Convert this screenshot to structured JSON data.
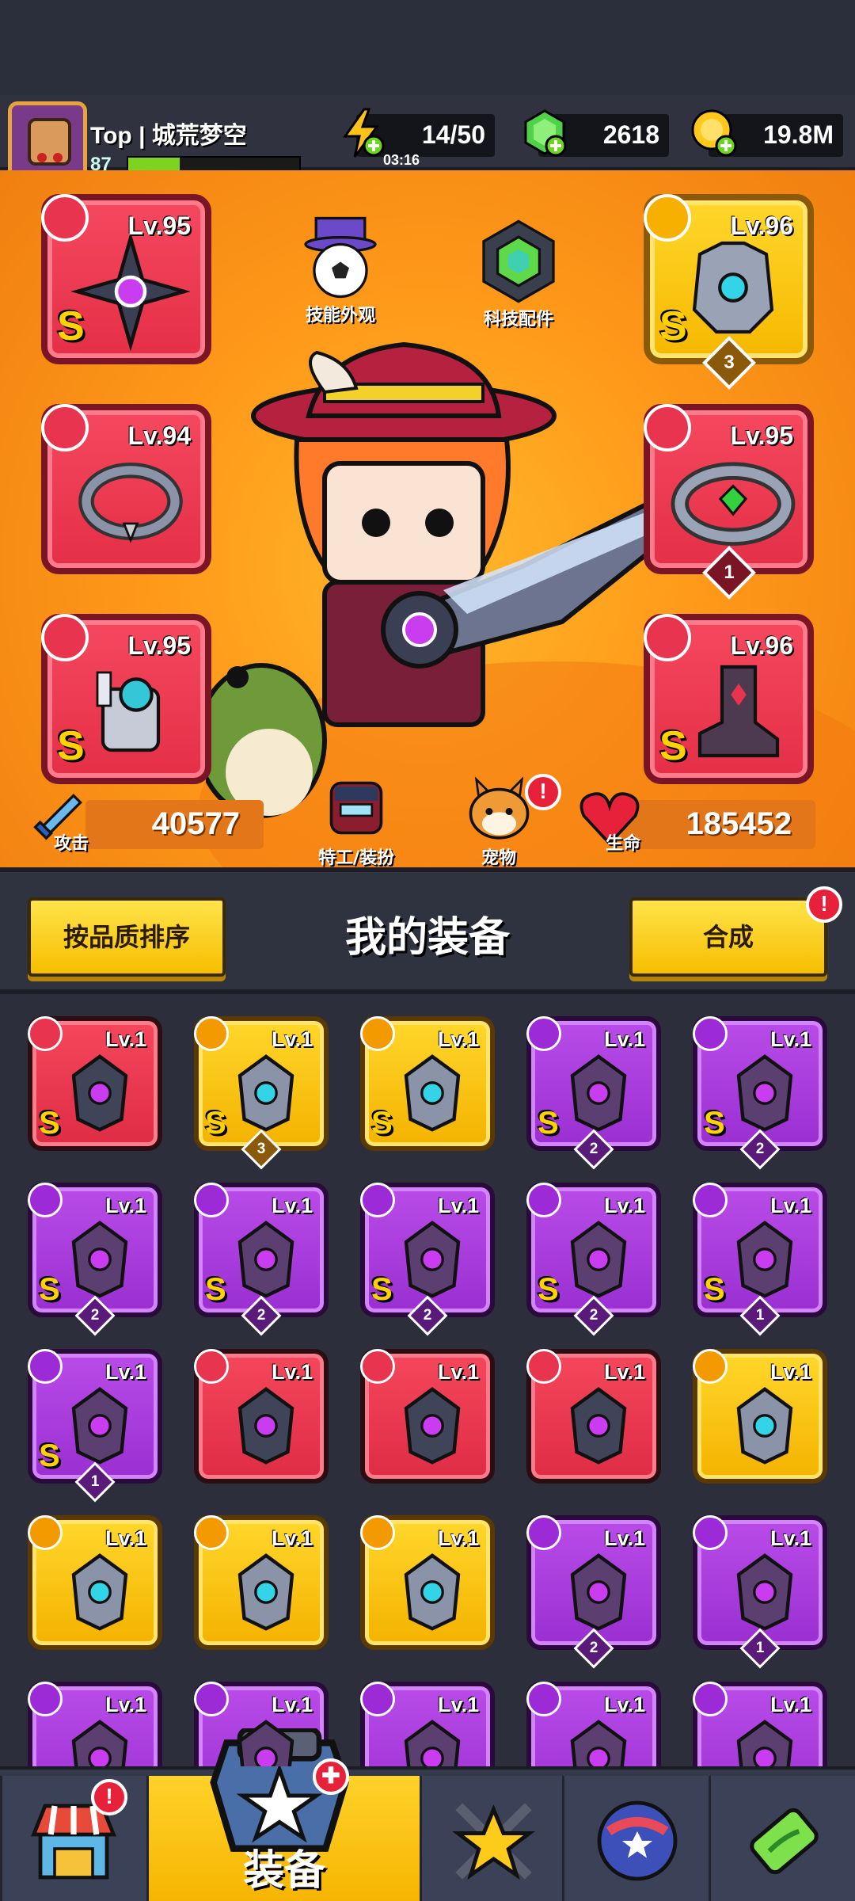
{
  "header": {
    "player_name": "Top | 城荒梦空",
    "player_level": "87",
    "xp_fraction": 0.3,
    "energy": "14/50",
    "energy_timer": "03:16",
    "gems": "2618",
    "coins": "19.8M"
  },
  "equipped": {
    "weapon": {
      "level": "Lv.95",
      "grade": "S"
    },
    "armor": {
      "level": "Lv.96",
      "grade": "S",
      "stars": "3"
    },
    "necklace": {
      "level": "Lv.94"
    },
    "ring": {
      "level": "Lv.95",
      "stars": "1"
    },
    "gloves": {
      "level": "Lv.95",
      "grade": "S"
    },
    "boots": {
      "level": "Lv.96",
      "grade": "S"
    }
  },
  "hero_buttons": {
    "skill_skin": "技能外观",
    "tech_parts": "科技配件",
    "agent_outfit": "特工/装扮",
    "pets": "宠物"
  },
  "stats": {
    "attack_label": "攻击",
    "attack_value": "40577",
    "hp_label": "生命",
    "hp_value": "185452"
  },
  "inventory_bar": {
    "sort_label": "按品质排序",
    "title": "我的装备",
    "merge_label": "合成"
  },
  "inventory": [
    {
      "rarity": "red",
      "level": "Lv.1",
      "grade": "S",
      "stars": ""
    },
    {
      "rarity": "gold",
      "level": "Lv.1",
      "grade": "S",
      "stars": "3"
    },
    {
      "rarity": "gold",
      "level": "Lv.1",
      "grade": "S",
      "stars": ""
    },
    {
      "rarity": "purple",
      "level": "Lv.1",
      "grade": "S",
      "stars": "2"
    },
    {
      "rarity": "purple",
      "level": "Lv.1",
      "grade": "S",
      "stars": "2"
    },
    {
      "rarity": "purple",
      "level": "Lv.1",
      "grade": "S",
      "stars": "2"
    },
    {
      "rarity": "purple",
      "level": "Lv.1",
      "grade": "S",
      "stars": "2"
    },
    {
      "rarity": "purple",
      "level": "Lv.1",
      "grade": "S",
      "stars": "2"
    },
    {
      "rarity": "purple",
      "level": "Lv.1",
      "grade": "S",
      "stars": "2"
    },
    {
      "rarity": "purple",
      "level": "Lv.1",
      "grade": "S",
      "stars": "1"
    },
    {
      "rarity": "purple",
      "level": "Lv.1",
      "grade": "S",
      "stars": "1"
    },
    {
      "rarity": "red",
      "level": "Lv.1",
      "grade": "",
      "stars": ""
    },
    {
      "rarity": "red",
      "level": "Lv.1",
      "grade": "",
      "stars": ""
    },
    {
      "rarity": "red",
      "level": "Lv.1",
      "grade": "",
      "stars": ""
    },
    {
      "rarity": "gold",
      "level": "Lv.1",
      "grade": "",
      "stars": ""
    },
    {
      "rarity": "gold",
      "level": "Lv.1",
      "grade": "",
      "stars": ""
    },
    {
      "rarity": "gold",
      "level": "Lv.1",
      "grade": "",
      "stars": ""
    },
    {
      "rarity": "gold",
      "level": "Lv.1",
      "grade": "",
      "stars": ""
    },
    {
      "rarity": "purple",
      "level": "Lv.1",
      "grade": "",
      "stars": "2"
    },
    {
      "rarity": "purple",
      "level": "Lv.1",
      "grade": "",
      "stars": "1"
    },
    {
      "rarity": "purple",
      "level": "Lv.1",
      "grade": "",
      "stars": ""
    },
    {
      "rarity": "purple",
      "level": "Lv.1",
      "grade": "",
      "stars": ""
    },
    {
      "rarity": "purple",
      "level": "Lv.1",
      "grade": "",
      "stars": ""
    },
    {
      "rarity": "purple",
      "level": "Lv.1",
      "grade": "",
      "stars": ""
    },
    {
      "rarity": "purple",
      "level": "Lv.1",
      "grade": "",
      "stars": ""
    }
  ],
  "bottom_nav": {
    "active_label": "装备"
  },
  "badges": {
    "alert": "!"
  }
}
